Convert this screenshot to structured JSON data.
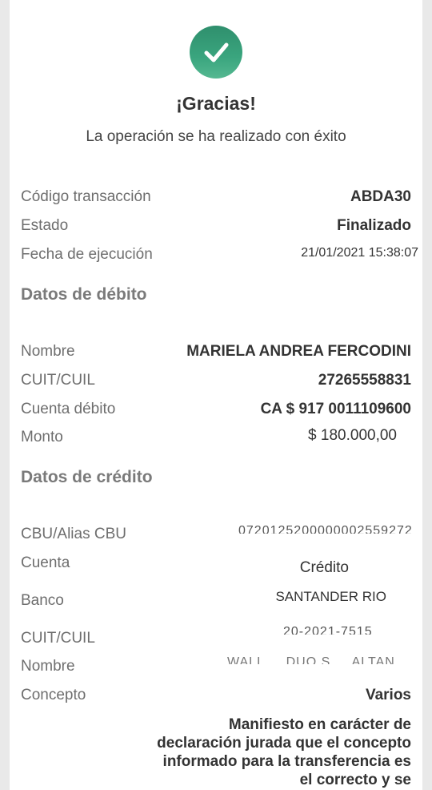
{
  "header": {
    "title": "¡Gracias!",
    "subtitle": "La operación se ha realizado con éxito"
  },
  "summary": {
    "codigo_label": "Código transacción",
    "codigo_value": "ABDA30",
    "estado_label": "Estado",
    "estado_value": "Finalizado",
    "fecha_label": "Fecha de ejecución",
    "fecha_value": "21/01/2021 15:38:07"
  },
  "debito": {
    "section_title": "Datos de débito",
    "nombre_label": "Nombre",
    "nombre_value": "MARIELA ANDREA FERCODINI",
    "cuit_label": "CUIT/CUIL",
    "cuit_value": "27265558831",
    "cuenta_label": "Cuenta débito",
    "cuenta_value": "CA $ 917 0011109600",
    "monto_label": "Monto",
    "monto_value": "$ 180.000,00"
  },
  "credito": {
    "section_title": "Datos de crédito",
    "cbu_label": "CBU/Alias CBU",
    "cbu_value": "0720125200000002559272",
    "cuenta_label": "Cuenta",
    "cuenta_value": "Crédito",
    "banco_label": "Banco",
    "banco_value": "SANTANDER RIO",
    "cuit_label": "CUIT/CUIL",
    "cuit_value": "20-2021-7515",
    "nombre_label": "Nombre",
    "nombre_value": "WALL ... DUO S ... ALTAN",
    "concepto_label": "Concepto",
    "concepto_value": "Varios",
    "declaracion": "Manifiesto en carácter de declaración jurada que el concepto informado para la transferencia es el correcto y se"
  },
  "icons": {
    "success": "check-circle-icon"
  },
  "colors": {
    "success_green": "#3aa57e",
    "label_gray": "#6e6e6e",
    "value_dark": "#333333"
  }
}
